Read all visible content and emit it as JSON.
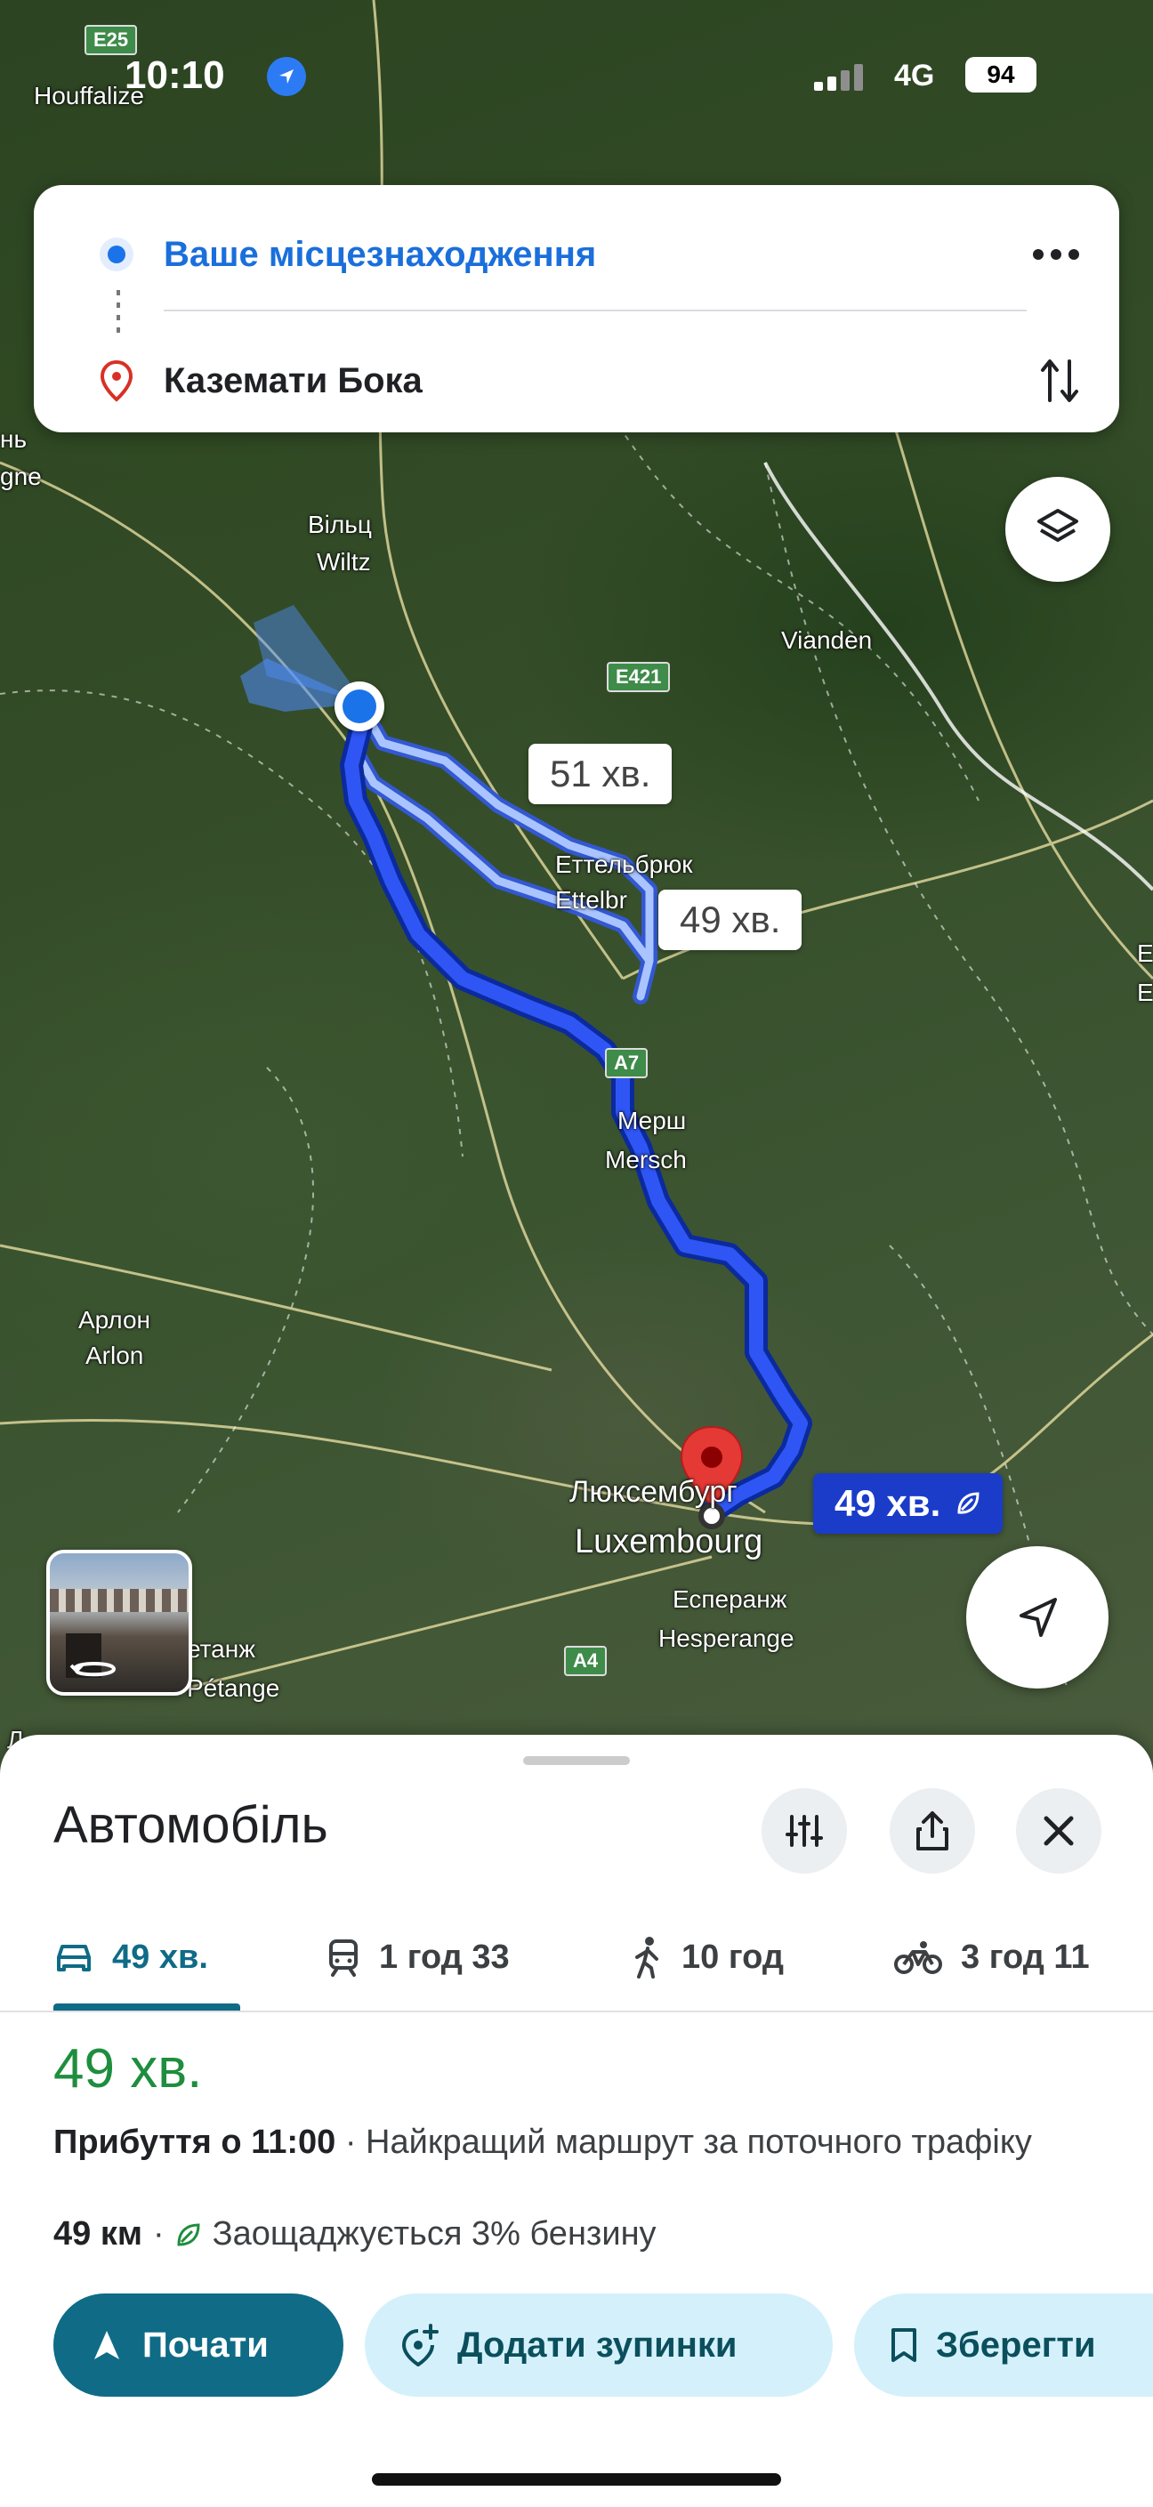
{
  "status_bar": {
    "time": "10:10",
    "network": "4G",
    "battery": "94"
  },
  "route": {
    "from": "Ваше місцезнаходження",
    "to": "Каземати Бока"
  },
  "map": {
    "labels": {
      "houffalize": "Houffalize",
      "e25": "E25",
      "viltz_cyr": "Вільц",
      "wiltz": "Wiltz",
      "vianden": "Vianden",
      "e421": "E421",
      "ettelbruck_cyr": "Еттельбрюк",
      "ettelbruck": "Ettelbr",
      "a7": "A7",
      "mersch_cyr": "Мерш",
      "mersch": "Mersch",
      "arlon_cyr": "Арлон",
      "arlon": "Arlon",
      "luxembourg_cyr": "Люксембург",
      "luxembourg": "Luxembourg",
      "hesperange_cyr": "Есперанж",
      "hesperange": "Hesperange",
      "a4": "A4",
      "petange_cyr": "етанж",
      "petange": "Pétange",
      "left1": "нь",
      "left2": "gne",
      "right_e1": "E",
      "right_e2": "E",
      "left_l": "Л"
    },
    "route_times": {
      "alt1": "51 хв.",
      "alt2": "49 хв.",
      "selected": "49 хв."
    }
  },
  "sheet": {
    "title": "Автомобіль",
    "modes": [
      {
        "icon": "car-icon",
        "label": "49 хв."
      },
      {
        "icon": "train-icon",
        "label": "1 год 33"
      },
      {
        "icon": "walk-icon",
        "label": "10 год"
      },
      {
        "icon": "bike-icon",
        "label": "3 год 11"
      }
    ],
    "duration": "49 хв.",
    "arrival": "Прибуття о 11:00",
    "arrival_note": " · Найкращий маршрут за поточного трафіку",
    "distance": "49 км",
    "separator": " · ",
    "fuel_note": "Заощаджується 3% бензину",
    "buttons": {
      "start": "Почати",
      "add_stops": "Додати зупинки",
      "save": "Зберегти"
    }
  },
  "colors": {
    "accent": "#0f6b86",
    "route_selected": "#1a3cc9",
    "route_alt": "#a9c4ff",
    "eta_green": "#1e8e3e"
  }
}
